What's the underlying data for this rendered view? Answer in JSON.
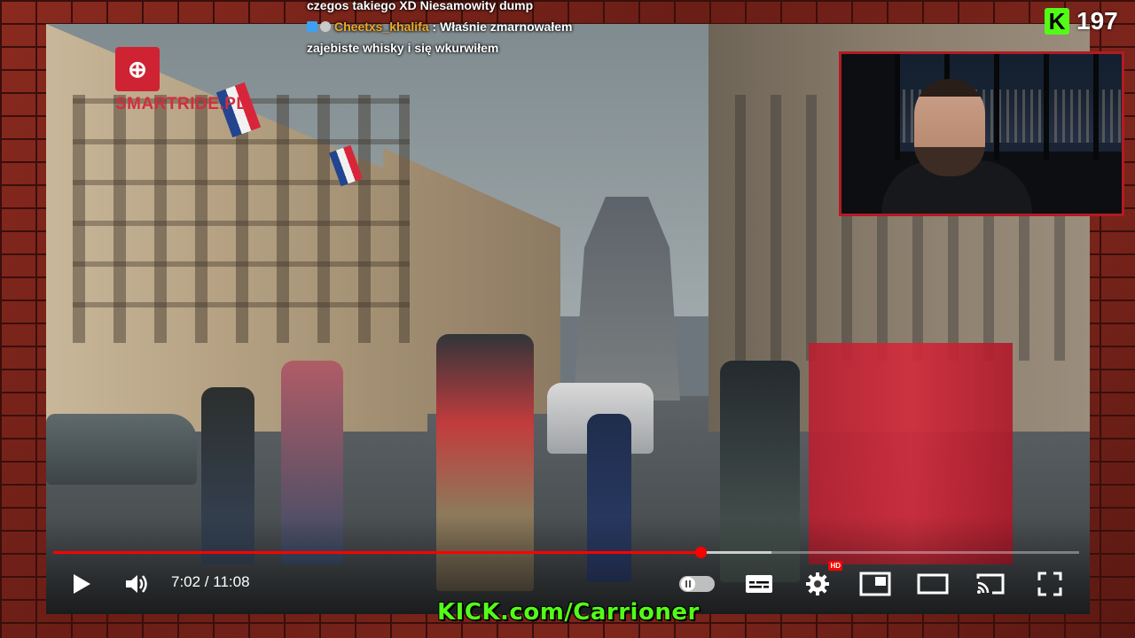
{
  "chat": {
    "line_top": "czegos takiego XD Niesamowity dump",
    "message": {
      "username": "Cheetxs_khalifa",
      "separator": ":",
      "text_line1": "Właśnie zmarnowałem",
      "text_line2": "zajebiste whisky i się wkurwiłem"
    }
  },
  "viewers": {
    "platform_icon": "kick-icon",
    "count": "197"
  },
  "video": {
    "watermark_text": "SMARTRIDE.PL",
    "watermark_logo": "smartride-logo",
    "time_display": "7:02 / 11:08",
    "progress_fraction": 0.631,
    "buffered_fraction": 0.7,
    "hd_badge": "HD",
    "icons": {
      "play": "play-icon",
      "volume": "volume-icon",
      "autoplay": "pause-icon",
      "subtitles": "subtitles-icon",
      "settings": "gear-icon",
      "miniplayer": "miniplayer-icon",
      "theater": "theater-icon",
      "cast": "cast-icon",
      "fullscreen": "fullscreen-icon"
    }
  },
  "banner": {
    "text": "KICK.com/Carrioner"
  },
  "colors": {
    "kick_green": "#53fc18",
    "progress_red": "#ff0000",
    "webcam_border": "#b21b24",
    "chat_username": "#f6a623"
  }
}
